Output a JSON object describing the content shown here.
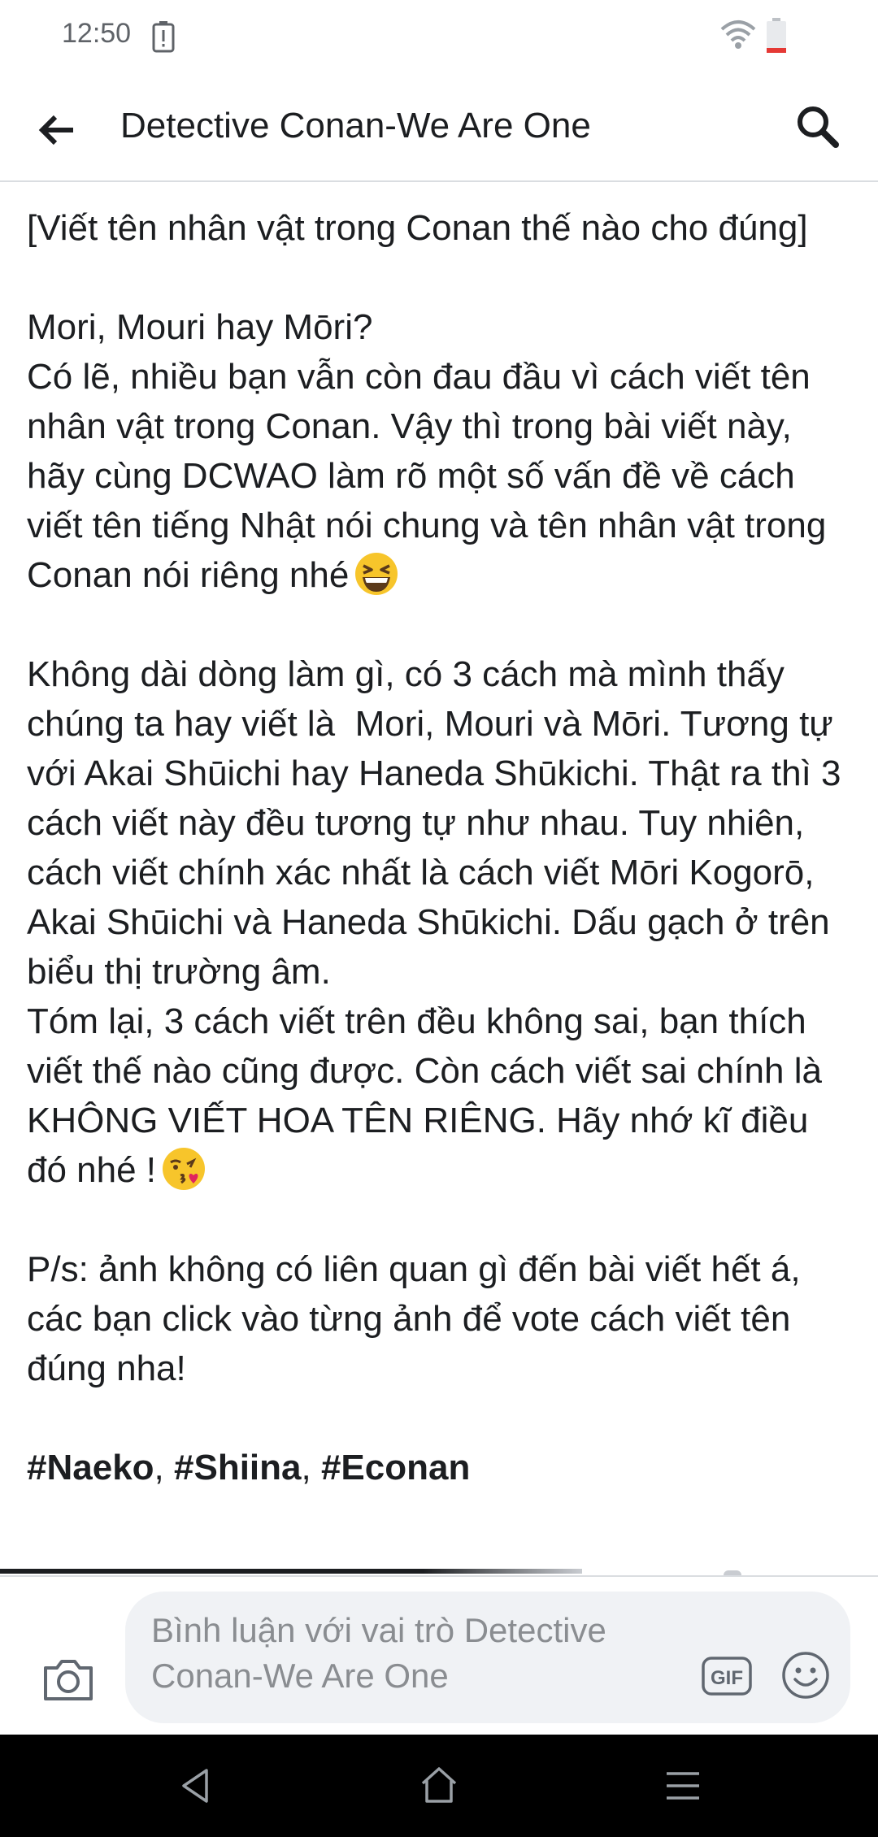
{
  "status_bar": {
    "time": "12:50",
    "icons": [
      "alert-icon",
      "wifi-icon",
      "battery-low-icon"
    ],
    "battery_color": "#e53935"
  },
  "header": {
    "title": "Detective Conan-We Are One",
    "back_icon": "arrow-left-icon",
    "search_icon": "search-icon"
  },
  "post": {
    "headline": "[Viết tên nhân vật trong Conan thế nào cho đúng]",
    "question": "Mori, Mouri hay Mōri?",
    "intro": "Có lẽ, nhiều bạn vẫn còn đau đầu vì cách viết tên nhân vật trong Conan. Vậy thì trong bài viết này, hãy cùng DCWAO làm rõ một số vấn đề về cách viết tên tiếng Nhật nói chung và tên nhân vật trong Conan nói riêng nhé",
    "intro_emoji": "grinning-squinting-face",
    "body": "Không dài dòng làm gì, có 3 cách mà mình thấy chúng ta hay viết là  Mori, Mouri và Mōri. Tương tự với Akai Shūichi hay Haneda Shūkichi. Thật ra thì 3 cách viết này đều tương tự như nhau. Tuy nhiên, cách viết chính xác nhất là cách viết Mōri Kogorō, Akai Shūichi và Haneda Shūkichi. Dấu gạch ở trên biểu thị trường âm.",
    "summary": "Tóm lại, 3 cách viết trên đều không sai, bạn thích viết thế nào cũng được. Còn cách viết sai chính là KHÔNG VIẾT HOA TÊN RIÊNG. Hãy nhớ kĩ điều đó nhé !",
    "summary_emoji": "face-blowing-kiss",
    "ps": "P/s: ảnh không có liên quan gì đến bài viết hết á, các bạn click vào từng ảnh để vote cách viết tên đúng nha!",
    "hashtags": [
      "#Naeko",
      "#Shiina",
      "#Econan"
    ],
    "hashtag_separator": ", "
  },
  "comment_bar": {
    "placeholder": "Bình luận với vai trò Detective Conan-We Are One",
    "camera_icon": "camera-icon",
    "gif_label": "GIF",
    "emoji_icon": "smile-icon"
  },
  "nav_bar": {
    "icons": [
      "nav-back-icon",
      "nav-home-icon",
      "nav-menu-icon"
    ]
  }
}
